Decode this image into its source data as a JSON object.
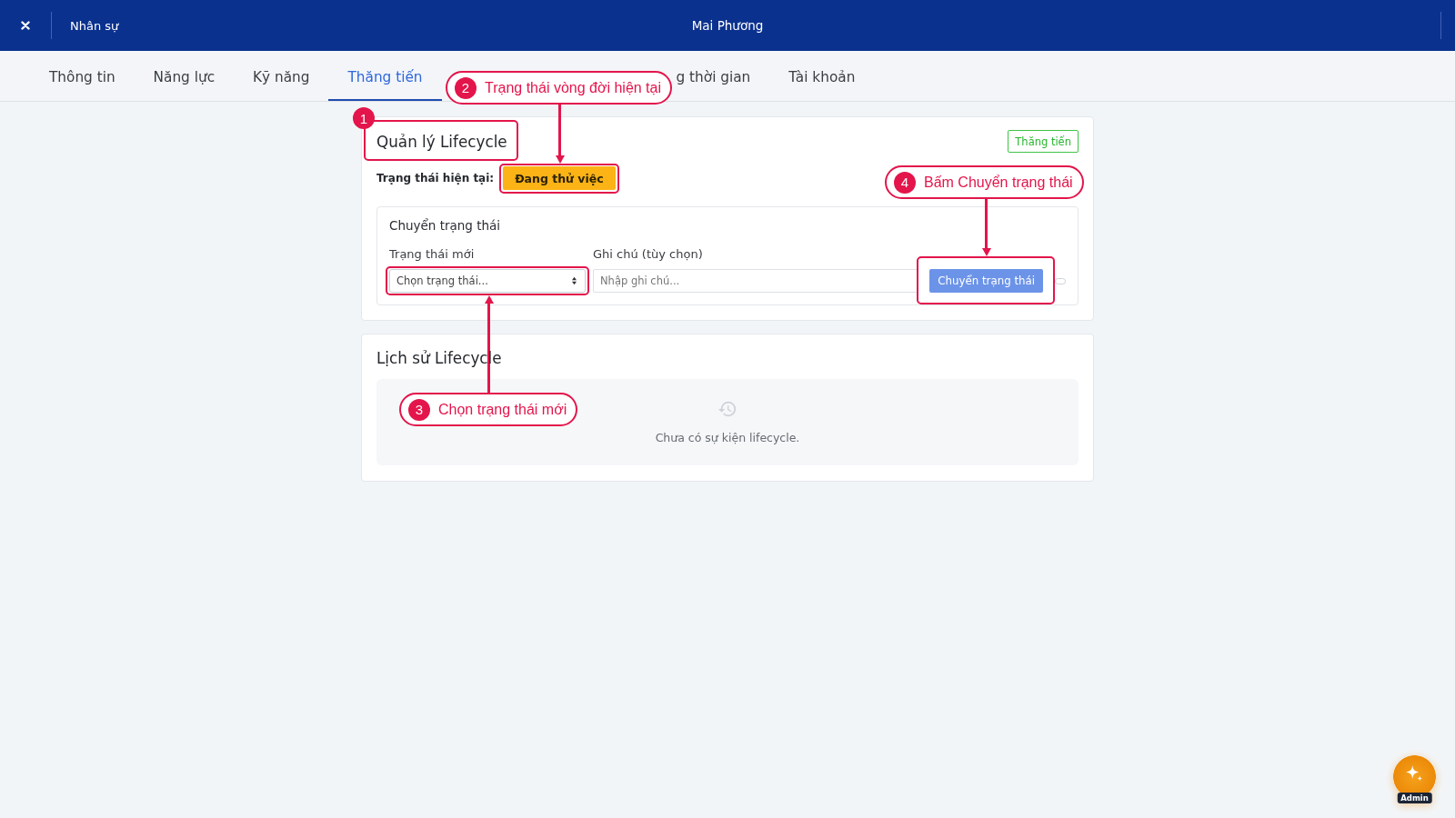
{
  "header": {
    "section": "Nhân sự",
    "title": "Mai Phương"
  },
  "tabs": [
    {
      "label": "Thông tin",
      "selected": false,
      "kind": "full"
    },
    {
      "label": "Năng lực",
      "selected": false,
      "kind": "full"
    },
    {
      "label": "Kỹ năng",
      "selected": false,
      "kind": "full"
    },
    {
      "label": "Thăng tiến",
      "selected": true,
      "kind": "full"
    },
    {
      "label": "g thời gian",
      "selected": false,
      "kind": "covered"
    },
    {
      "label": "Tài khoản",
      "selected": false,
      "kind": "full"
    }
  ],
  "lifecycle_card": {
    "title": "Quản lý Lifecycle",
    "tag": "Thăng tiến",
    "current_label": "Trạng thái hiện tại:",
    "current_status": "Đang thử việc",
    "transition": {
      "title": "Chuyển trạng thái",
      "new_status": {
        "label": "Trạng thái mới",
        "placeholder": "Chọn trạng thái..."
      },
      "note": {
        "label": "Ghi chú (tùy chọn)",
        "placeholder": "Nhập ghi chú..."
      },
      "submit": {
        "label": "Chuyển trạng thái",
        "disabled": true
      }
    }
  },
  "history_card": {
    "title": "Lịch sử Lifecycle",
    "empty_text": "Chưa có sự kiện lifecycle."
  },
  "floating_button": {
    "badge": "Admin"
  },
  "annotations": [
    {
      "number": "1"
    },
    {
      "number": "2",
      "text": "Trạng thái vòng đời hiện tại"
    },
    {
      "number": "3",
      "text": "Chọn trạng thái mới"
    },
    {
      "number": "4",
      "text": "Bấm Chuyển trạng thái"
    }
  ]
}
